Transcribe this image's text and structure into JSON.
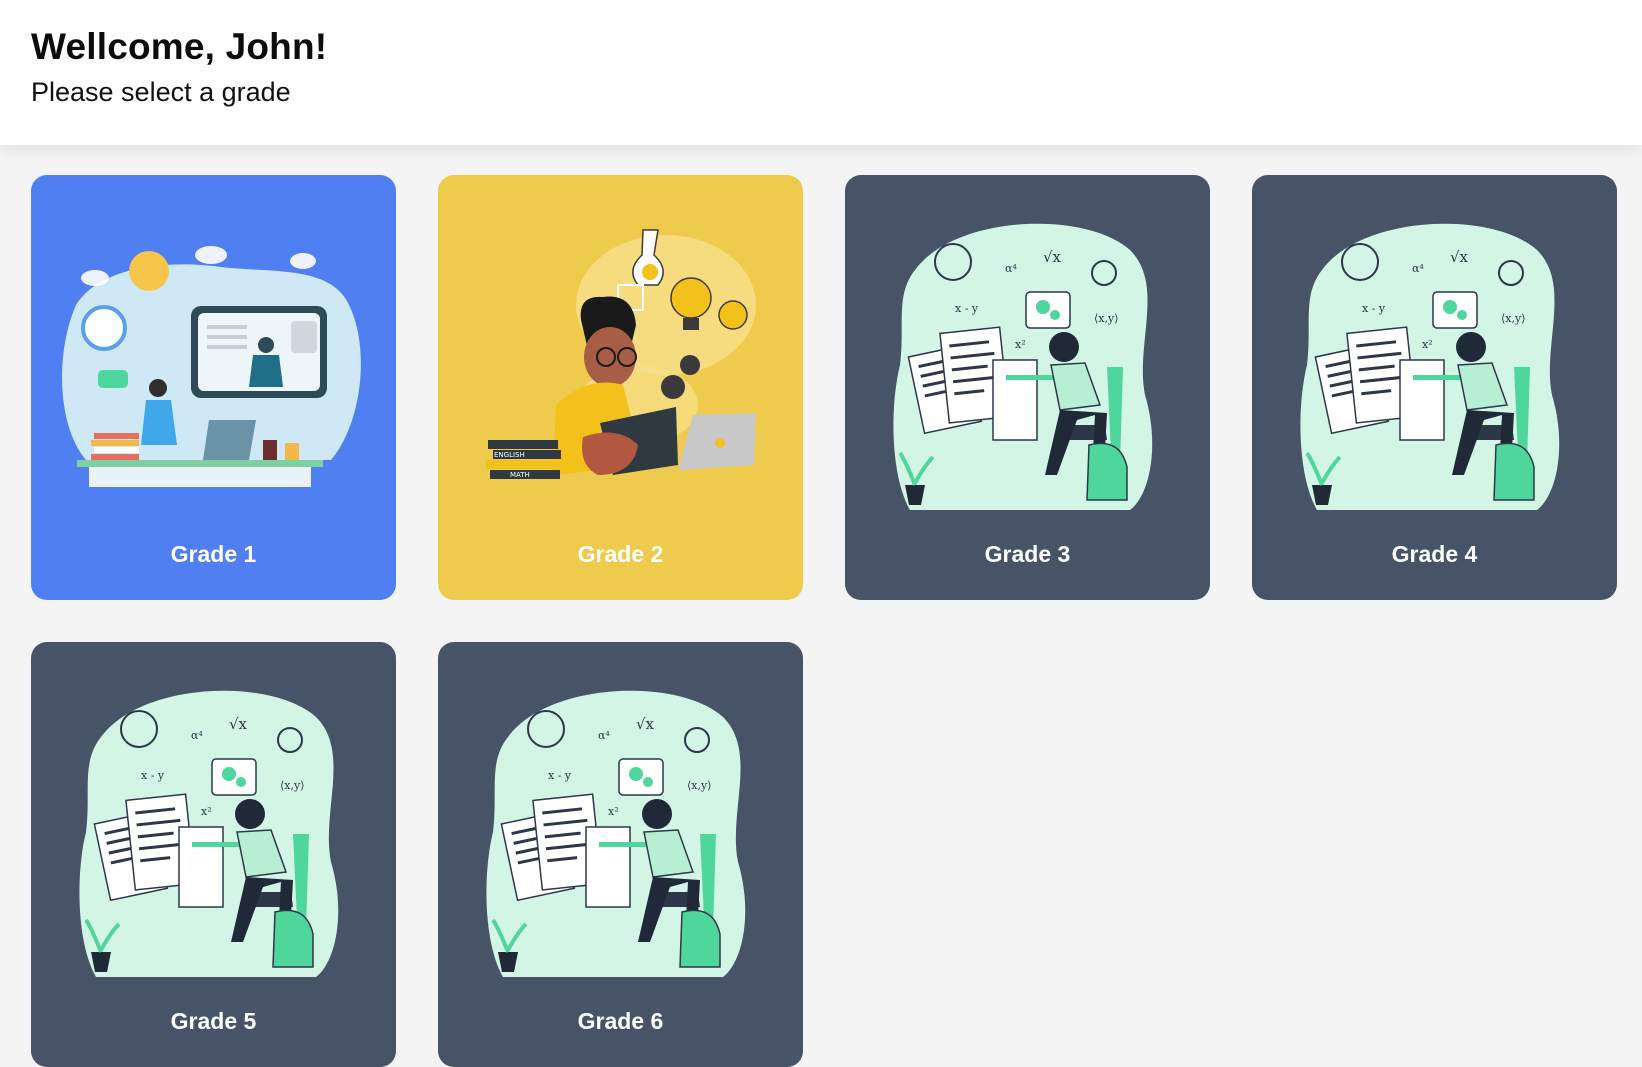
{
  "header": {
    "title": "Wellcome, John!",
    "subtitle": "Please select a grade"
  },
  "colors": {
    "blue_card": "#4f7ff0",
    "yellow_card": "#eecb4d",
    "dark_card": "#475467",
    "mint_blob": "#d3f5e6",
    "accent_green": "#4fd69c"
  },
  "grades": [
    {
      "label": "Grade 1",
      "theme": "blue",
      "illustration": "online-class-illustration"
    },
    {
      "label": "Grade 2",
      "theme": "yellow",
      "illustration": "student-reading-illustration"
    },
    {
      "label": "Grade 3",
      "theme": "dark",
      "illustration": "student-exam-illustration"
    },
    {
      "label": "Grade 4",
      "theme": "dark",
      "illustration": "student-exam-illustration"
    },
    {
      "label": "Grade 5",
      "theme": "dark",
      "illustration": "student-exam-illustration"
    },
    {
      "label": "Grade 6",
      "theme": "dark",
      "illustration": "student-exam-illustration"
    }
  ]
}
